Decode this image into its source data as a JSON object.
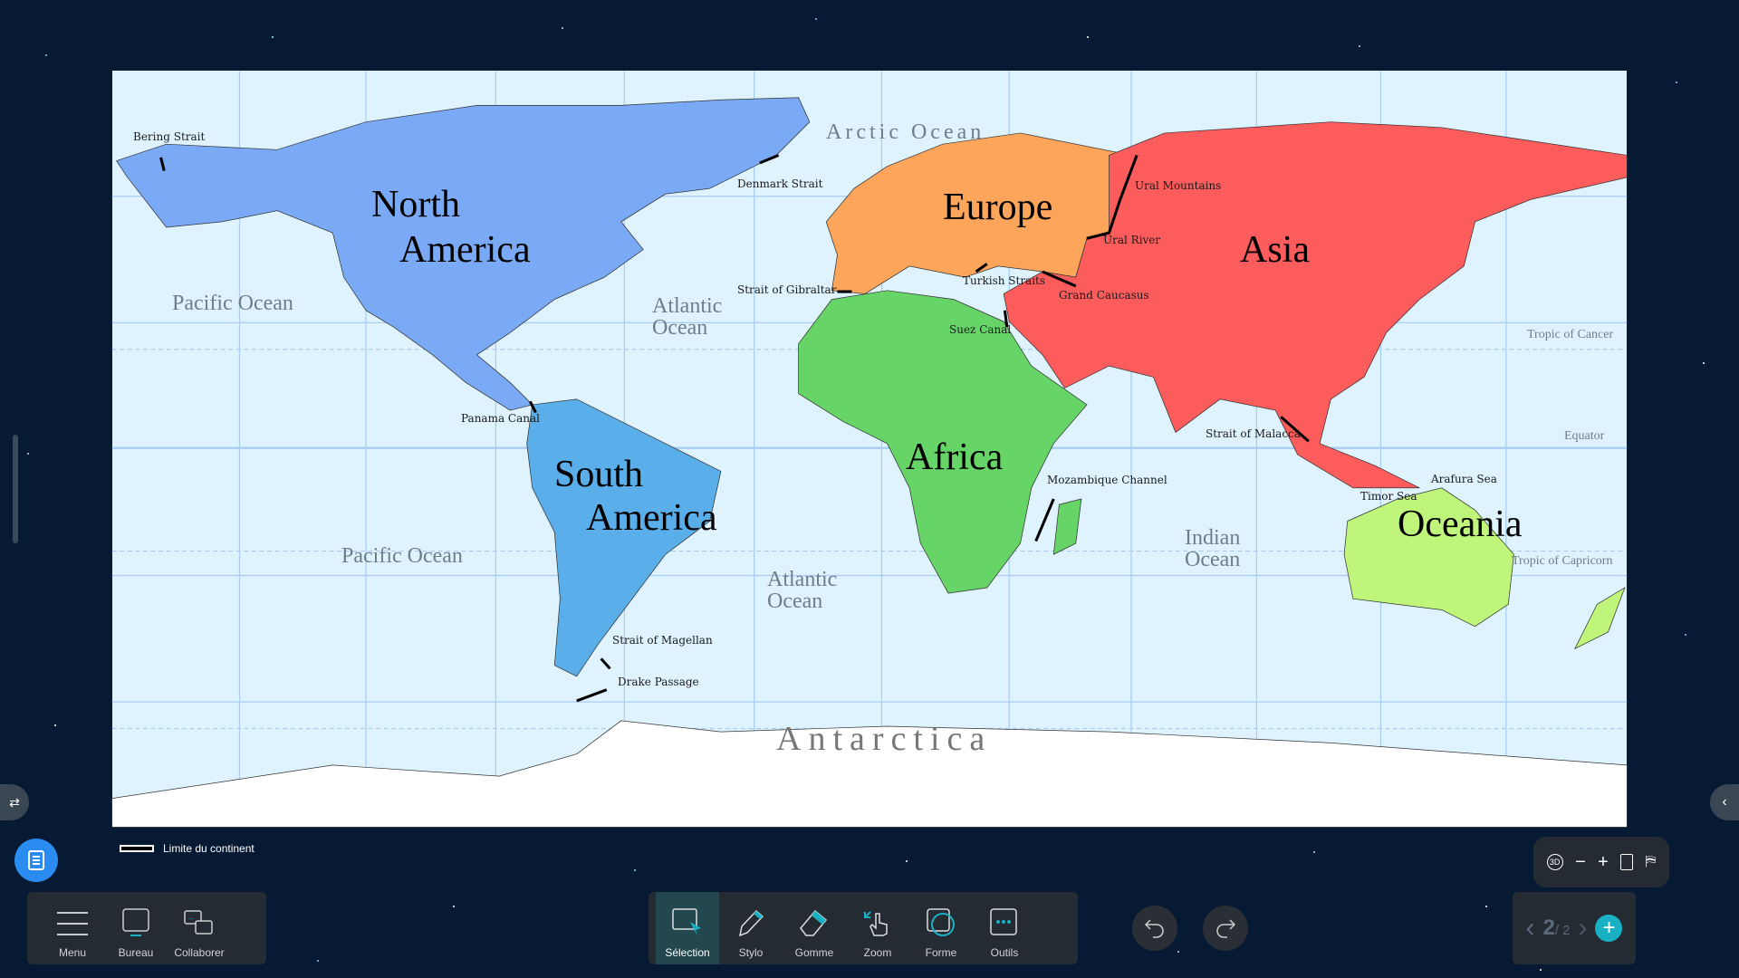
{
  "map": {
    "continents": {
      "north_america_1": "North",
      "north_america_2": "America",
      "south_america_1": "South",
      "south_america_2": "America",
      "europe": "Europe",
      "asia": "Asia",
      "africa": "Africa",
      "oceania": "Oceania",
      "antarctica": "Antarctica"
    },
    "oceans": {
      "pacific_north": "Pacific Ocean",
      "pacific_south": "Pacific Ocean",
      "atlantic_north": "Atlantic Ocean",
      "atlantic_south": "Atlantic Ocean",
      "indian": "Indian Ocean",
      "arctic": "Arctic Ocean"
    },
    "features": {
      "bering": "Bering Strait",
      "denmark": "Denmark Strait",
      "ural_mountains": "Ural Mountains",
      "ural_river": "Ural River",
      "gibraltar": "Strait of Gibraltar",
      "turkish": "Turkish Straits",
      "caucasus": "Grand Caucasus",
      "suez": "Suez Canal",
      "panama": "Panama Canal",
      "malacca": "Strait of Malacca",
      "mozambique": "Mozambique Channel",
      "arafura": "Arafura Sea",
      "timor": "Timor Sea",
      "magellan": "Strait of Magellan",
      "drake": "Drake Passage"
    },
    "lines": {
      "cancer": "Tropic of Cancer",
      "equator": "Equator",
      "capricorn": "Tropic of Capricorn"
    },
    "colors": {
      "north_america": "#7aaaf5",
      "south_america": "#5aaeea",
      "europe": "#fda55b",
      "asia": "#fd5c5c",
      "africa": "#66d466",
      "oceania": "#bef57a",
      "antarctica": "#ffffff",
      "ocean": "#dff3fe"
    }
  },
  "legend": {
    "label": "Limite du continent"
  },
  "left_toolbar": [
    {
      "label": "Menu",
      "icon": "menu-icon"
    },
    {
      "label": "Bureau",
      "icon": "desktop-icon"
    },
    {
      "label": "Collaborer",
      "icon": "collaborate-icon"
    }
  ],
  "center_toolbar": [
    {
      "label": "Sélection",
      "icon": "selection-icon",
      "active": true
    },
    {
      "label": "Stylo",
      "icon": "pen-icon"
    },
    {
      "label": "Gomme",
      "icon": "eraser-icon"
    },
    {
      "label": "Zoom",
      "icon": "zoom-hand-icon"
    },
    {
      "label": "Forme",
      "icon": "shape-icon"
    },
    {
      "label": "Outils",
      "icon": "tools-icon"
    }
  ],
  "view_controls": {
    "rotate": "3D"
  },
  "pager": {
    "current": "2",
    "total": "/ 2"
  },
  "accent": "#1ab0c4"
}
